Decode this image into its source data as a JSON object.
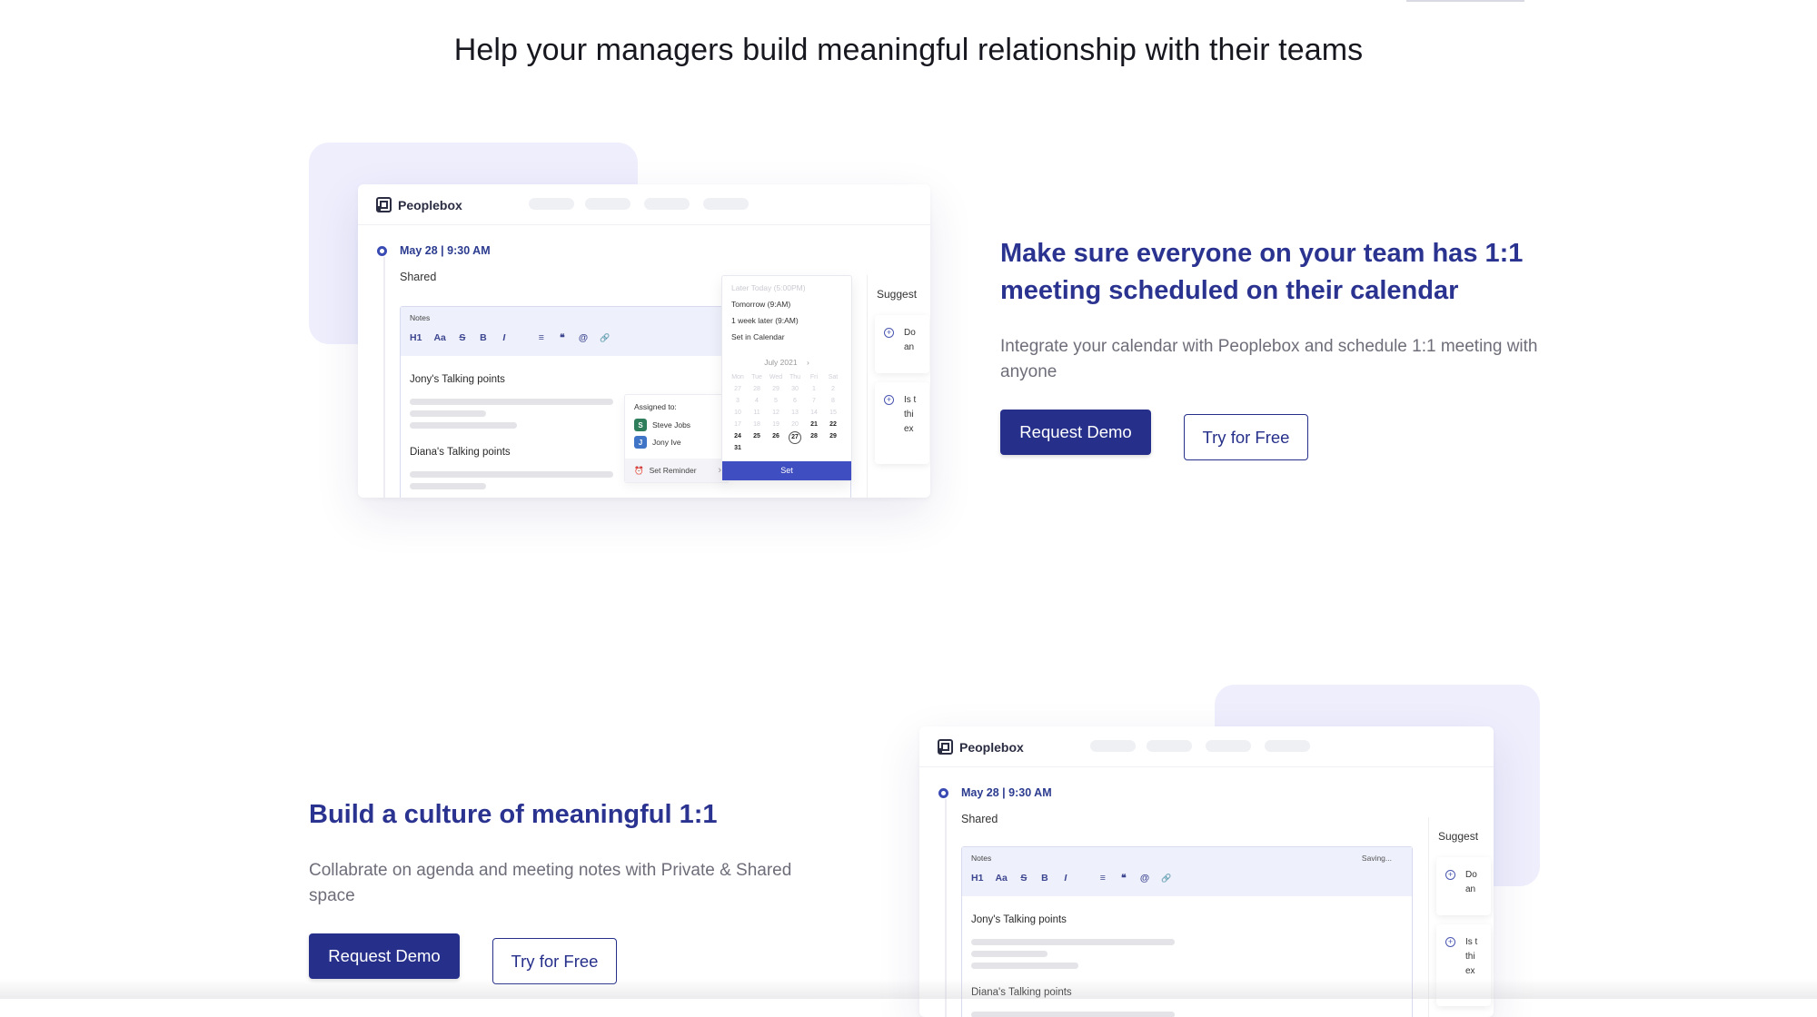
{
  "page": {
    "heading": "Help your managers build meaningful relationship with their teams"
  },
  "mockup": {
    "brand": "Peoplebox",
    "date": "May 28 | 9:30 AM",
    "shared": "Shared",
    "notes_title": "Notes",
    "saving": "Saving...",
    "toolbar": [
      "H1",
      "Aa",
      "S",
      "B",
      "I",
      "≡",
      "❝",
      "@",
      "🔗"
    ],
    "jony_points": "Jony's Talking points",
    "diana_points": "Diana's Talking points",
    "assigned_to": "Assigned to:",
    "assignees": [
      {
        "initial": "S",
        "name": "Steve Jobs",
        "color": "#2e7d5b"
      },
      {
        "initial": "J",
        "name": "Jony Ive",
        "color": "#3f74c6"
      }
    ],
    "set_reminder": "Set Reminder",
    "reminder_options": [
      "Later Today (5:00PM)",
      "Tomorrow (9:AM)",
      "1 week later (9:AM)",
      "Set in Calendar"
    ],
    "calendar_month": "July 2021",
    "calendar_weekdays": [
      "Mon",
      "Tue",
      "Wed",
      "Thu",
      "Fri",
      "Sat"
    ],
    "calendar_days": [
      [
        "27",
        "28",
        "29",
        "30",
        "1",
        "2"
      ],
      [
        "3",
        "4",
        "5",
        "6",
        "7",
        "8"
      ],
      [
        "10",
        "11",
        "12",
        "13",
        "14",
        "15"
      ],
      [
        "17",
        "18",
        "19",
        "20",
        "21",
        "22"
      ],
      [
        "24",
        "25",
        "26",
        "27",
        "28",
        "29"
      ],
      [
        "31",
        "",
        "",
        "",
        "",
        ""
      ]
    ],
    "set_button": "Set",
    "suggest_title": "Suggest",
    "suggest_cards": [
      {
        "lines": [
          "Do",
          "an"
        ]
      },
      {
        "lines": [
          "Is t",
          "thi",
          "ex"
        ]
      }
    ]
  },
  "feature1": {
    "title": "Make sure everyone on your team has 1:1 meeting scheduled on their calendar",
    "description": "Integrate your calendar with Peoplebox and schedule 1:1 meeting with anyone",
    "primary_button": "Request Demo",
    "secondary_button": "Try for Free"
  },
  "feature2": {
    "title": "Build a culture of meaningful 1:1",
    "description": "Collabrate on agenda and meeting notes with Private & Shared space",
    "primary_button": "Request Demo",
    "secondary_button": "Try for Free"
  },
  "colors": {
    "accent": "#26308a",
    "title": "#2b3390",
    "mock_bg": "#eeeefd"
  }
}
